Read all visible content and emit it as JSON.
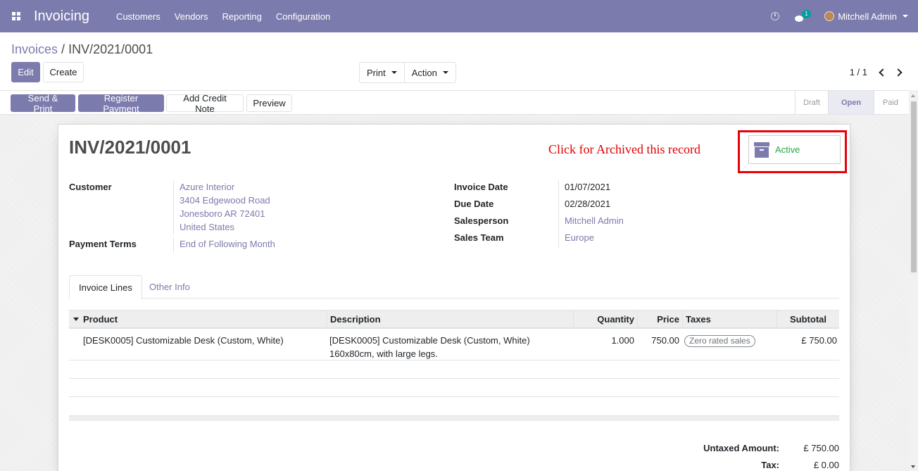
{
  "navbar": {
    "app_title": "Invoicing",
    "menu": [
      "Customers",
      "Vendors",
      "Reporting",
      "Configuration"
    ],
    "chat_badge": "1",
    "user": "Mitchell Admin",
    "color": "#7c7bad"
  },
  "breadcrumb": {
    "parent": "Invoices",
    "separator": " / ",
    "current": "INV/2021/0001"
  },
  "control": {
    "edit": "Edit",
    "create": "Create",
    "print": "Print",
    "action": "Action",
    "pager": "1 / 1"
  },
  "statusbar": {
    "buttons": [
      "Send & Print",
      "Register Payment",
      "Add Credit Note",
      "Preview"
    ],
    "stages": [
      "Draft",
      "Open",
      "Paid"
    ],
    "current_stage": "Open"
  },
  "sheet": {
    "title": "INV/2021/0001",
    "annotation": "Click for Archived this record",
    "active_button": "Active",
    "customer_label": "Customer",
    "customer_lines": [
      "Azure Interior",
      "3404 Edgewood Road",
      "Jonesboro AR 72401",
      "United States"
    ],
    "payment_terms_label": "Payment Terms",
    "payment_terms": "End of Following Month",
    "invoice_date_label": "Invoice Date",
    "invoice_date": "01/07/2021",
    "due_date_label": "Due Date",
    "due_date": "02/28/2021",
    "salesperson_label": "Salesperson",
    "salesperson": "Mitchell Admin",
    "sales_team_label": "Sales Team",
    "sales_team": "Europe"
  },
  "tabs": [
    "Invoice Lines",
    "Other Info"
  ],
  "table": {
    "headers": [
      "Product",
      "Description",
      "Quantity",
      "Price",
      "Taxes",
      "Subtotal"
    ],
    "rows": [
      {
        "product": "[DESK0005] Customizable Desk (Custom, White)",
        "description_line1": "[DESK0005] Customizable Desk (Custom, White)",
        "description_line2": "160x80cm, with large legs.",
        "quantity": "1.000",
        "price": "750.00",
        "tax": "Zero rated sales",
        "subtotal": "£ 750.00"
      }
    ]
  },
  "totals": {
    "untaxed_label": "Untaxed Amount:",
    "untaxed": "£ 750.00",
    "tax_label": "Tax:",
    "tax": "£ 0.00"
  }
}
